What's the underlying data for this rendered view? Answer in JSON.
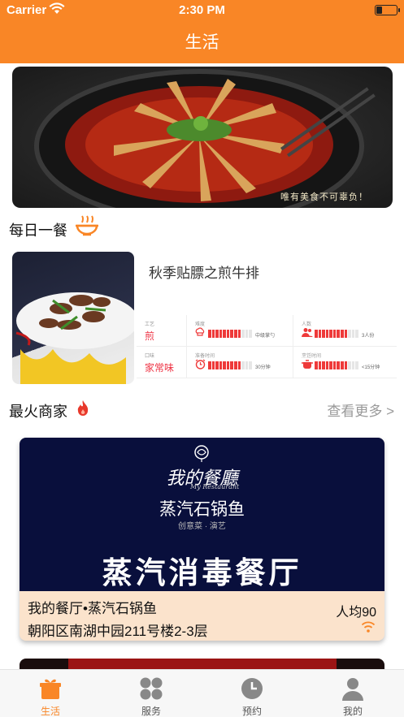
{
  "status_bar": {
    "carrier": "Carrier",
    "time": "2:30 PM"
  },
  "header": {
    "title": "生活"
  },
  "banner": {
    "caption": "唯有美食不可辜负！"
  },
  "daily": {
    "section_title": "每日一餐",
    "meal_name": "秋季贴膘之煎牛排",
    "stats": [
      {
        "label": "工艺",
        "value": "煎"
      },
      {
        "label": "难度",
        "note": "中级掌勺",
        "level": 0.75
      },
      {
        "label": "人数",
        "note": "3人份",
        "level": 0.75
      },
      {
        "label": "口味",
        "value": "家常味"
      },
      {
        "label": "准备时间",
        "note": "30分钟",
        "level": 0.75
      },
      {
        "label": "烹饪时间",
        "note": "<15分钟",
        "level": 0.75
      }
    ]
  },
  "hot": {
    "section_title": "最火商家",
    "more_label": "查看更多 >",
    "merchant": {
      "brand": "我的餐廳",
      "brand_en": "My Restaurant",
      "dish": "蒸汽石锅鱼",
      "cuisine": "创意菜 · 演艺",
      "slogan": "蒸汽消毒餐厅",
      "name": "我的餐厅•蒸汽石锅鱼",
      "price": "人均90",
      "address": "朝阳区南湖中园211号楼2-3层"
    }
  },
  "tabs": [
    {
      "label": "生活",
      "icon": "gift-icon",
      "active": true
    },
    {
      "label": "服务",
      "icon": "grid-icon",
      "active": false
    },
    {
      "label": "预约",
      "icon": "clock-icon",
      "active": false
    },
    {
      "label": "我的",
      "icon": "user-icon",
      "active": false
    }
  ],
  "colors": {
    "accent": "#f98626",
    "danger": "#ee3a3a",
    "merchant_bg": "#090f3c"
  }
}
